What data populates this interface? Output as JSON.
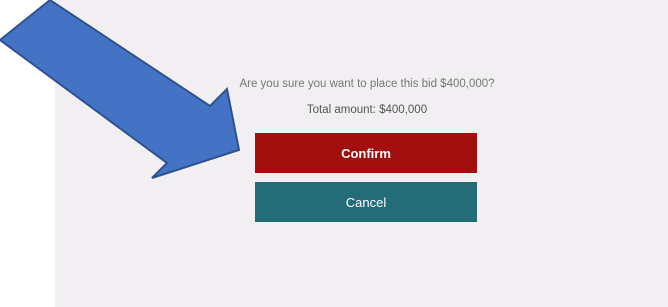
{
  "dialog": {
    "question": "Are you sure you want to place this bid $400,000?",
    "total": "Total amount: $400,000",
    "confirm_label": "Confirm",
    "cancel_label": "Cancel"
  },
  "annotation": {
    "icon": "arrow-pointer-icon",
    "color": "#4472c4",
    "stroke": "#2f528f"
  },
  "colors": {
    "confirm": "#a30f0f",
    "cancel": "#256c79",
    "dialog_bg": "#f2eff2"
  }
}
